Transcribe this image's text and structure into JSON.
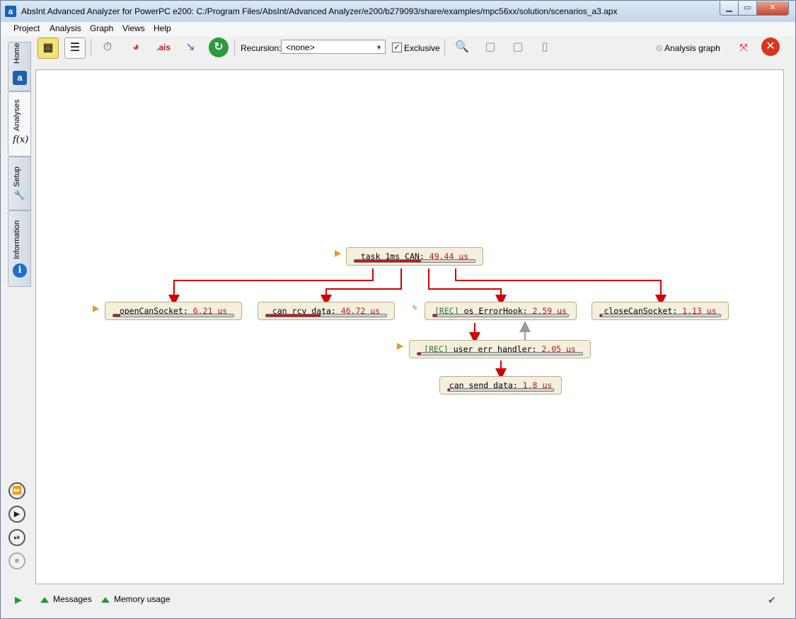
{
  "window": {
    "title": "AbsInt Advanced Analyzer for PowerPC e200: C:/Program Files/AbsInt/Advanced Analyzer/e200/b279093/share/examples/mpc56xx/solution/scenarios_a3.apx"
  },
  "menu": [
    "Project",
    "Analysis",
    "Graph",
    "Views",
    "Help"
  ],
  "left_tabs": [
    "Home",
    "Analyses",
    "Setup",
    "Information"
  ],
  "toolbar": {
    "recursion_label": "Recursion:",
    "recursion_value": "<none>",
    "exclusive_label": "Exclusive",
    "exclusive_checked": true,
    "analysis_graph_label": "Analysis graph"
  },
  "graph": {
    "nodes": [
      {
        "id": "task",
        "rec": "",
        "name": "task_1ms_CAN:",
        "time": "49.44 µs",
        "fill": 0.55
      },
      {
        "id": "open",
        "rec": "",
        "name": "openCanSocket:",
        "time": "6.21 µs",
        "fill": 0.06
      },
      {
        "id": "rcv",
        "rec": "",
        "name": "can_rcv_data:",
        "time": "46.72 µs",
        "fill": 0.45
      },
      {
        "id": "err",
        "rec": "[REC]",
        "name": "os_ErrorHook:",
        "time": "2.59 µs",
        "fill": 0.03
      },
      {
        "id": "close",
        "rec": "",
        "name": "closeCanSocket:",
        "time": "1.13 µs",
        "fill": 0.01
      },
      {
        "id": "user",
        "rec": "[REC]",
        "name": "user_err_handler:",
        "time": "2.05 µs",
        "fill": 0.02
      },
      {
        "id": "send",
        "rec": "",
        "name": "can_send_data:",
        "time": "1.8 µs",
        "fill": 0.02
      }
    ]
  },
  "status": {
    "messages_label": "Messages",
    "memory_label": "Memory usage"
  },
  "colors": {
    "edge": "#d10000",
    "back_edge": "#9a9a9a",
    "time": "#b81c1c",
    "rec": "#2e7a2e"
  }
}
